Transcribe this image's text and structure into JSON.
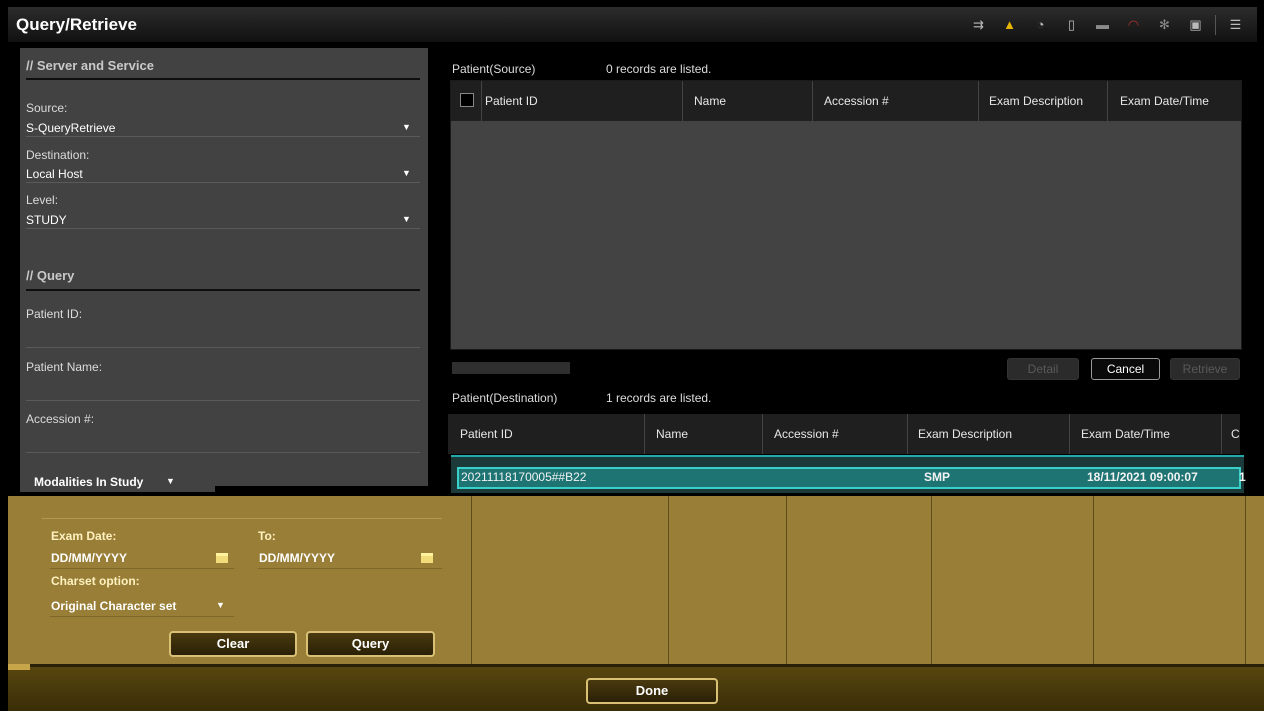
{
  "window": {
    "title": "Query/Retrieve",
    "status_icons": [
      "transfer-icon",
      "warning-icon",
      "media-icon",
      "mouse-icon",
      "print-icon",
      "network-icon",
      "gear-icon",
      "archive-icon",
      "menu-icon"
    ]
  },
  "server_service": {
    "heading": "Server and Service",
    "source_label": "Source:",
    "source_value": "S-QueryRetrieve",
    "destination_label": "Destination:",
    "destination_value": "Local Host",
    "level_label": "Level:",
    "level_value": "STUDY"
  },
  "query": {
    "heading": "Query",
    "patient_id_label": "Patient ID:",
    "patient_id_value": "",
    "patient_name_label": "Patient Name:",
    "patient_name_value": "",
    "accession_label": "Accession #:",
    "accession_value": "",
    "modalities_label": "Modalities In Study",
    "exam_date_label": "Exam Date:",
    "exam_date_value": "DD/MM/YYYY",
    "to_label": "To:",
    "to_value": "DD/MM/YYYY",
    "charset_label": "Charset option:",
    "charset_value": "Original Character set",
    "clear_label": "Clear",
    "query_label": "Query"
  },
  "source_table": {
    "heading": "Patient(Source)",
    "count": "0 records are listed.",
    "columns": [
      "Patient ID",
      "Name",
      "Accession #",
      "Exam Description",
      "Exam Date/Time"
    ]
  },
  "source_actions": {
    "detail_label": "Detail",
    "cancel_label": "Cancel",
    "retrieve_label": "Retrieve"
  },
  "destination_table": {
    "heading": "Patient(Destination)",
    "count": "1 records are listed.",
    "columns": [
      "Patient ID",
      "Name",
      "Accession #",
      "Exam Description",
      "Exam Date/Time",
      "C"
    ],
    "rows": [
      {
        "patient_id": "20211118170005##B22",
        "name": "",
        "accession": "",
        "exam_description": "SMP",
        "exam_datetime": "18/11/2021 09:00:07",
        "c": "1"
      }
    ]
  },
  "footer": {
    "done_label": "Done"
  },
  "colors": {
    "panel_gray": "#424242",
    "gold": "#987e36",
    "highlight_teal": "#1e7373",
    "highlight_border": "#38d0c8"
  }
}
